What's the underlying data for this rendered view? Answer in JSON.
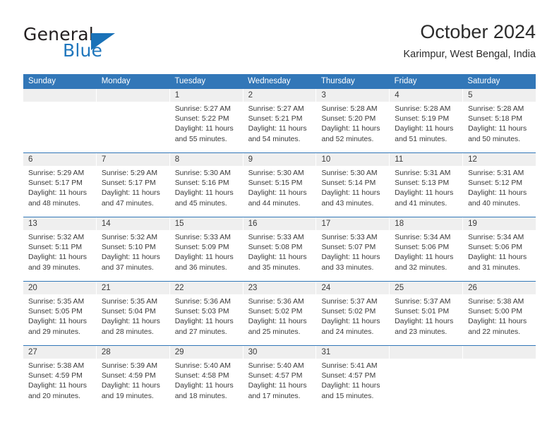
{
  "brand": {
    "name_top": "General",
    "name_bottom": "Blue",
    "triangle_icon": "blue-triangle-logo-mark",
    "color_dark": "#231f20",
    "color_blue": "#2077bd"
  },
  "header": {
    "title": "October 2024",
    "subtitle": "Karimpur, West Bengal, India"
  },
  "theme": {
    "header_blue": "#3277b8",
    "date_band_gray": "#efefef",
    "text": "#3a3a3a"
  },
  "weekdays": [
    "Sunday",
    "Monday",
    "Tuesday",
    "Wednesday",
    "Thursday",
    "Friday",
    "Saturday"
  ],
  "weeks": [
    [
      {
        "day": "",
        "sunrise": "",
        "sunset": "",
        "daylight_line1": "",
        "daylight_line2": "",
        "empty": true
      },
      {
        "day": "",
        "sunrise": "",
        "sunset": "",
        "daylight_line1": "",
        "daylight_line2": "",
        "empty": true
      },
      {
        "day": "1",
        "sunrise": "Sunrise: 5:27 AM",
        "sunset": "Sunset: 5:22 PM",
        "daylight_line1": "Daylight: 11 hours",
        "daylight_line2": "and 55 minutes."
      },
      {
        "day": "2",
        "sunrise": "Sunrise: 5:27 AM",
        "sunset": "Sunset: 5:21 PM",
        "daylight_line1": "Daylight: 11 hours",
        "daylight_line2": "and 54 minutes."
      },
      {
        "day": "3",
        "sunrise": "Sunrise: 5:28 AM",
        "sunset": "Sunset: 5:20 PM",
        "daylight_line1": "Daylight: 11 hours",
        "daylight_line2": "and 52 minutes."
      },
      {
        "day": "4",
        "sunrise": "Sunrise: 5:28 AM",
        "sunset": "Sunset: 5:19 PM",
        "daylight_line1": "Daylight: 11 hours",
        "daylight_line2": "and 51 minutes."
      },
      {
        "day": "5",
        "sunrise": "Sunrise: 5:28 AM",
        "sunset": "Sunset: 5:18 PM",
        "daylight_line1": "Daylight: 11 hours",
        "daylight_line2": "and 50 minutes."
      }
    ],
    [
      {
        "day": "6",
        "sunrise": "Sunrise: 5:29 AM",
        "sunset": "Sunset: 5:17 PM",
        "daylight_line1": "Daylight: 11 hours",
        "daylight_line2": "and 48 minutes."
      },
      {
        "day": "7",
        "sunrise": "Sunrise: 5:29 AM",
        "sunset": "Sunset: 5:17 PM",
        "daylight_line1": "Daylight: 11 hours",
        "daylight_line2": "and 47 minutes."
      },
      {
        "day": "8",
        "sunrise": "Sunrise: 5:30 AM",
        "sunset": "Sunset: 5:16 PM",
        "daylight_line1": "Daylight: 11 hours",
        "daylight_line2": "and 45 minutes."
      },
      {
        "day": "9",
        "sunrise": "Sunrise: 5:30 AM",
        "sunset": "Sunset: 5:15 PM",
        "daylight_line1": "Daylight: 11 hours",
        "daylight_line2": "and 44 minutes."
      },
      {
        "day": "10",
        "sunrise": "Sunrise: 5:30 AM",
        "sunset": "Sunset: 5:14 PM",
        "daylight_line1": "Daylight: 11 hours",
        "daylight_line2": "and 43 minutes."
      },
      {
        "day": "11",
        "sunrise": "Sunrise: 5:31 AM",
        "sunset": "Sunset: 5:13 PM",
        "daylight_line1": "Daylight: 11 hours",
        "daylight_line2": "and 41 minutes."
      },
      {
        "day": "12",
        "sunrise": "Sunrise: 5:31 AM",
        "sunset": "Sunset: 5:12 PM",
        "daylight_line1": "Daylight: 11 hours",
        "daylight_line2": "and 40 minutes."
      }
    ],
    [
      {
        "day": "13",
        "sunrise": "Sunrise: 5:32 AM",
        "sunset": "Sunset: 5:11 PM",
        "daylight_line1": "Daylight: 11 hours",
        "daylight_line2": "and 39 minutes."
      },
      {
        "day": "14",
        "sunrise": "Sunrise: 5:32 AM",
        "sunset": "Sunset: 5:10 PM",
        "daylight_line1": "Daylight: 11 hours",
        "daylight_line2": "and 37 minutes."
      },
      {
        "day": "15",
        "sunrise": "Sunrise: 5:33 AM",
        "sunset": "Sunset: 5:09 PM",
        "daylight_line1": "Daylight: 11 hours",
        "daylight_line2": "and 36 minutes."
      },
      {
        "day": "16",
        "sunrise": "Sunrise: 5:33 AM",
        "sunset": "Sunset: 5:08 PM",
        "daylight_line1": "Daylight: 11 hours",
        "daylight_line2": "and 35 minutes."
      },
      {
        "day": "17",
        "sunrise": "Sunrise: 5:33 AM",
        "sunset": "Sunset: 5:07 PM",
        "daylight_line1": "Daylight: 11 hours",
        "daylight_line2": "and 33 minutes."
      },
      {
        "day": "18",
        "sunrise": "Sunrise: 5:34 AM",
        "sunset": "Sunset: 5:06 PM",
        "daylight_line1": "Daylight: 11 hours",
        "daylight_line2": "and 32 minutes."
      },
      {
        "day": "19",
        "sunrise": "Sunrise: 5:34 AM",
        "sunset": "Sunset: 5:06 PM",
        "daylight_line1": "Daylight: 11 hours",
        "daylight_line2": "and 31 minutes."
      }
    ],
    [
      {
        "day": "20",
        "sunrise": "Sunrise: 5:35 AM",
        "sunset": "Sunset: 5:05 PM",
        "daylight_line1": "Daylight: 11 hours",
        "daylight_line2": "and 29 minutes."
      },
      {
        "day": "21",
        "sunrise": "Sunrise: 5:35 AM",
        "sunset": "Sunset: 5:04 PM",
        "daylight_line1": "Daylight: 11 hours",
        "daylight_line2": "and 28 minutes."
      },
      {
        "day": "22",
        "sunrise": "Sunrise: 5:36 AM",
        "sunset": "Sunset: 5:03 PM",
        "daylight_line1": "Daylight: 11 hours",
        "daylight_line2": "and 27 minutes."
      },
      {
        "day": "23",
        "sunrise": "Sunrise: 5:36 AM",
        "sunset": "Sunset: 5:02 PM",
        "daylight_line1": "Daylight: 11 hours",
        "daylight_line2": "and 25 minutes."
      },
      {
        "day": "24",
        "sunrise": "Sunrise: 5:37 AM",
        "sunset": "Sunset: 5:02 PM",
        "daylight_line1": "Daylight: 11 hours",
        "daylight_line2": "and 24 minutes."
      },
      {
        "day": "25",
        "sunrise": "Sunrise: 5:37 AM",
        "sunset": "Sunset: 5:01 PM",
        "daylight_line1": "Daylight: 11 hours",
        "daylight_line2": "and 23 minutes."
      },
      {
        "day": "26",
        "sunrise": "Sunrise: 5:38 AM",
        "sunset": "Sunset: 5:00 PM",
        "daylight_line1": "Daylight: 11 hours",
        "daylight_line2": "and 22 minutes."
      }
    ],
    [
      {
        "day": "27",
        "sunrise": "Sunrise: 5:38 AM",
        "sunset": "Sunset: 4:59 PM",
        "daylight_line1": "Daylight: 11 hours",
        "daylight_line2": "and 20 minutes."
      },
      {
        "day": "28",
        "sunrise": "Sunrise: 5:39 AM",
        "sunset": "Sunset: 4:59 PM",
        "daylight_line1": "Daylight: 11 hours",
        "daylight_line2": "and 19 minutes."
      },
      {
        "day": "29",
        "sunrise": "Sunrise: 5:40 AM",
        "sunset": "Sunset: 4:58 PM",
        "daylight_line1": "Daylight: 11 hours",
        "daylight_line2": "and 18 minutes."
      },
      {
        "day": "30",
        "sunrise": "Sunrise: 5:40 AM",
        "sunset": "Sunset: 4:57 PM",
        "daylight_line1": "Daylight: 11 hours",
        "daylight_line2": "and 17 minutes."
      },
      {
        "day": "31",
        "sunrise": "Sunrise: 5:41 AM",
        "sunset": "Sunset: 4:57 PM",
        "daylight_line1": "Daylight: 11 hours",
        "daylight_line2": "and 15 minutes."
      },
      {
        "day": "",
        "sunrise": "",
        "sunset": "",
        "daylight_line1": "",
        "daylight_line2": "",
        "empty": true
      },
      {
        "day": "",
        "sunrise": "",
        "sunset": "",
        "daylight_line1": "",
        "daylight_line2": "",
        "empty": true
      }
    ]
  ]
}
